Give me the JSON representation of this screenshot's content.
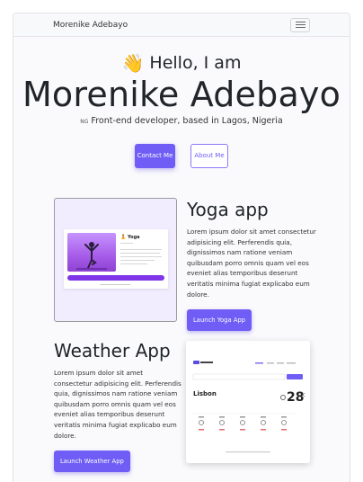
{
  "navbar": {
    "brand": "Morenike Adebayo",
    "menu_icon": "hamburger-icon"
  },
  "hero": {
    "wave_icon": "waving-hand-emoji",
    "wave": "👋",
    "hello": "Hello, I am",
    "name": "Morenike Adebayo",
    "flag": "NG",
    "tagline": "Front-end developer, based in Lagos, Nigeria",
    "contact_label": "Contact Me",
    "about_label": "About Me"
  },
  "projects": [
    {
      "title": "Yoga app",
      "description": "Lorem ipsum dolor sit amet consectetur adipisicing elit. Perferendis quia, dignissimos nam ratione veniam quibusdam porro omnis quam vel eos eveniet alias temporibus deserunt veritatis minima fugiat explicabo eum dolore.",
      "button": "Launch Yoga App",
      "thumb_title": "🧘 Yoga"
    },
    {
      "title": "Weather App",
      "description": "Lorem ipsum dolor sit amet consectetur adipisicing elit. Perferendis quia, dignissimos nam ratione veniam quibusdam porro omnis quam vel eos eveniet alias temporibus deserunt veritatis minima fugiat explicabo eum dolore.",
      "button": "Launch Weather App",
      "thumb_city": "Lisbon",
      "thumb_temp": "28",
      "thumb_unit": "°C"
    }
  ],
  "colors": {
    "accent": "#6f5df5",
    "yoga_purple": "#a65be8"
  }
}
